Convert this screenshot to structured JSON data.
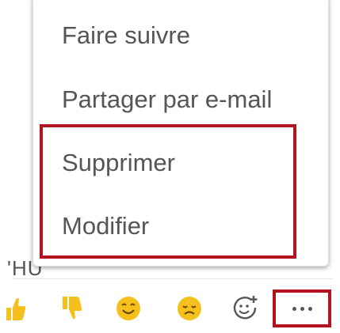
{
  "background_message": {
    "text": "'HU"
  },
  "context_menu": {
    "items": [
      {
        "label": "Faire suivre"
      },
      {
        "label": "Partager par e-mail"
      },
      {
        "label": "Supprimer"
      },
      {
        "label": "Modifier"
      }
    ]
  },
  "reactions": [
    {
      "icon": "thumbs-up-icon"
    },
    {
      "icon": "thumbs-down-icon"
    },
    {
      "icon": "happy-face-icon"
    },
    {
      "icon": "sad-face-icon"
    },
    {
      "icon": "add-reaction-icon"
    }
  ],
  "more_button": {
    "icon": "more-options-icon"
  },
  "colors": {
    "highlight": "#b3121f",
    "emoji_yellow": "#f5c01b",
    "text": "#555555"
  }
}
